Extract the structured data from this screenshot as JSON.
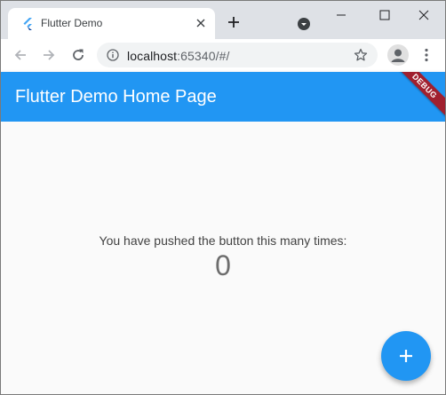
{
  "browser": {
    "tab": {
      "title": "Flutter Demo",
      "favicon": "flutter-logo-icon"
    },
    "omnibox": {
      "url_host": "localhost",
      "url_rest": ":65340/#/"
    }
  },
  "app": {
    "appbar_title": "Flutter Demo Home Page",
    "debug_banner": "DEBUG",
    "counter_message": "You have pushed the button this many times:",
    "counter_value": "0",
    "fab_icon": "add-icon"
  },
  "colors": {
    "primary": "#2196f3",
    "debug_banner": "#a0202f",
    "tabstrip": "#dee1e6"
  }
}
